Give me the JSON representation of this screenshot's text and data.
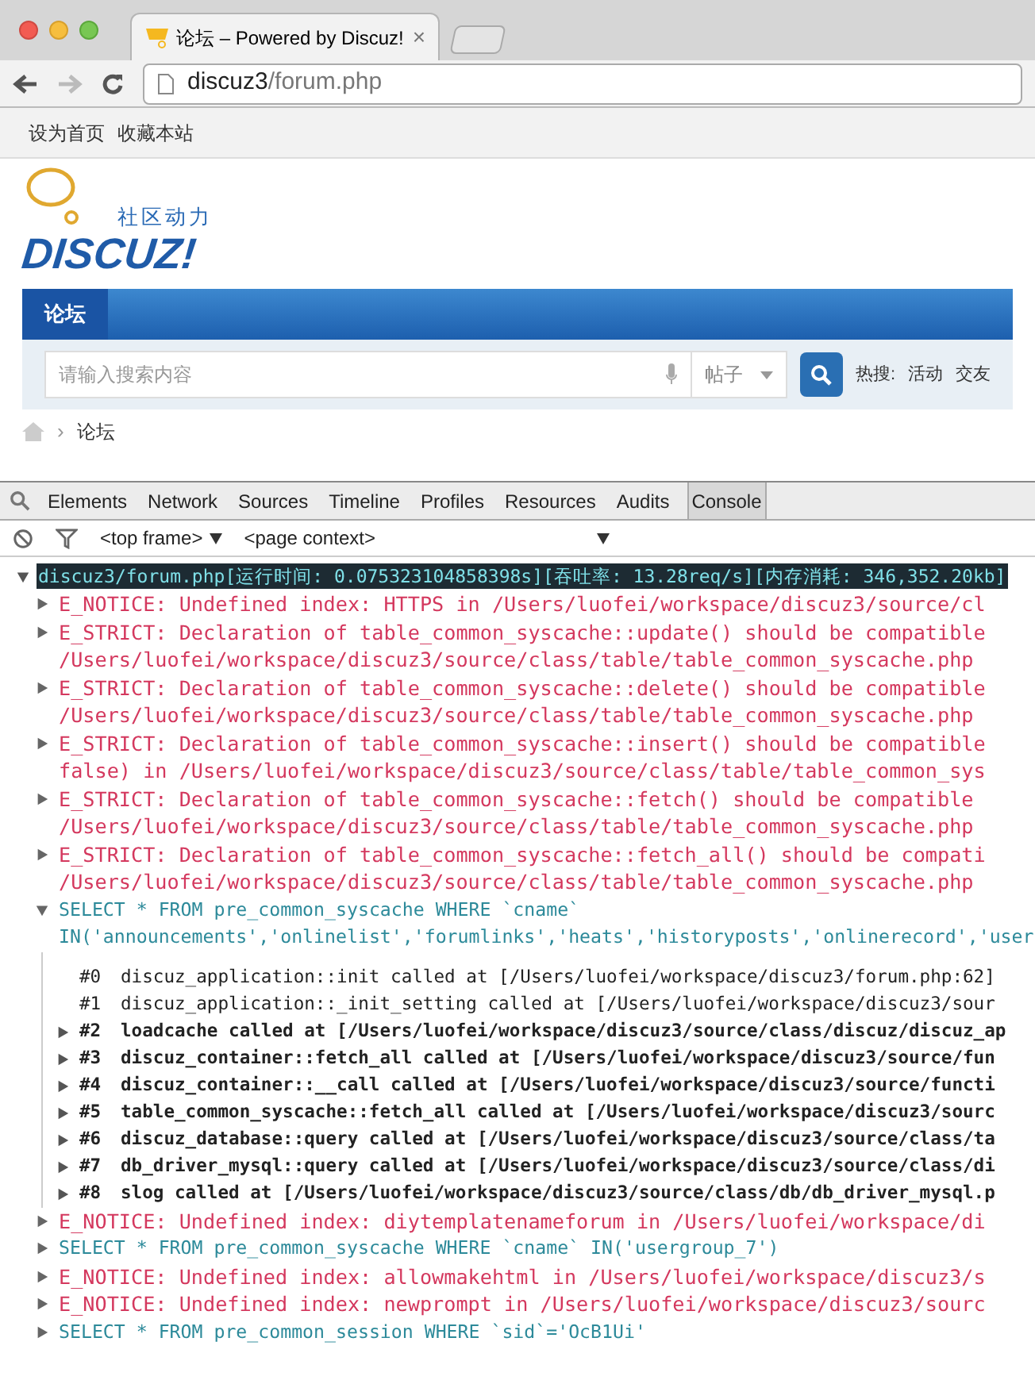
{
  "browser": {
    "tab": {
      "title": "论坛 – Powered by Discuz!",
      "close": "×"
    },
    "address": {
      "host": "discuz3",
      "path": "/forum.php"
    }
  },
  "page": {
    "top_links": [
      "设为首页",
      "收藏本站"
    ],
    "logo": {
      "slogan": "社区动力",
      "name": "DISCUZ!"
    },
    "nav": [
      {
        "label": "论坛",
        "selected": true
      }
    ],
    "search": {
      "placeholder": "请输入搜索内容",
      "type": "帖子",
      "hot_label": "热搜:",
      "hot": [
        "活动",
        "交友"
      ]
    },
    "breadcrumb": [
      {
        "separator": "›",
        "label": "论坛"
      }
    ]
  },
  "devtools": {
    "tabs": [
      {
        "label": "Elements",
        "selected": false
      },
      {
        "label": "Network",
        "selected": false
      },
      {
        "label": "Sources",
        "selected": false
      },
      {
        "label": "Timeline",
        "selected": false
      },
      {
        "label": "Profiles",
        "selected": false
      },
      {
        "label": "Resources",
        "selected": false
      },
      {
        "label": "Audits",
        "selected": false
      },
      {
        "label": "Console",
        "selected": true
      }
    ],
    "frame": "<top frame>",
    "context": "<page context>",
    "group": {
      "title": "discuz3/forum.php[运行时间: 0.075323104858398s][吞吐率: 13.28req/s][内存消耗: 346,352.20kb]",
      "expanded": true,
      "entries": [
        {
          "kind": "error",
          "expanded": false,
          "lines": [
            "E_NOTICE: Undefined index: HTTPS in /Users/luofei/workspace/discuz3/source/cl"
          ]
        },
        {
          "kind": "error",
          "expanded": false,
          "lines": [
            "E_STRICT: Declaration of table_common_syscache::update() should be compatible",
            "/Users/luofei/workspace/discuz3/source/class/table/table_common_syscache.php"
          ]
        },
        {
          "kind": "error",
          "expanded": false,
          "lines": [
            "E_STRICT: Declaration of table_common_syscache::delete() should be compatible",
            "/Users/luofei/workspace/discuz3/source/class/table/table_common_syscache.php"
          ]
        },
        {
          "kind": "error",
          "expanded": false,
          "lines": [
            "E_STRICT: Declaration of table_common_syscache::insert() should be compatible",
            "false) in /Users/luofei/workspace/discuz3/source/class/table/table_common_sys"
          ]
        },
        {
          "kind": "error",
          "expanded": false,
          "lines": [
            "E_STRICT: Declaration of table_common_syscache::fetch() should be compatible",
            "/Users/luofei/workspace/discuz3/source/class/table/table_common_syscache.php"
          ]
        },
        {
          "kind": "error",
          "expanded": false,
          "lines": [
            "E_STRICT: Declaration of table_common_syscache::fetch_all() should be compati",
            "/Users/luofei/workspace/discuz3/source/class/table/table_common_syscache.php"
          ]
        },
        {
          "kind": "sql",
          "expanded": true,
          "lines": [
            "SELECT * FROM pre_common_syscache WHERE `cname`",
            "IN('announcements','onlinelist','forumlinks','heats','historyposts','onlinerecord','user"
          ],
          "trace": [
            {
              "frame": "#0",
              "text": "discuz_application::init called at [/Users/luofei/workspace/discuz3/forum.php:62]",
              "expandable": false
            },
            {
              "frame": "#1",
              "text": "discuz_application::_init_setting called at [/Users/luofei/workspace/discuz3/sour",
              "expandable": false
            },
            {
              "frame": "#2",
              "text": "loadcache called at [/Users/luofei/workspace/discuz3/source/class/discuz/discuz_ap",
              "expandable": true
            },
            {
              "frame": "#3",
              "text": "discuz_container::fetch_all called at [/Users/luofei/workspace/discuz3/source/fun",
              "expandable": true
            },
            {
              "frame": "#4",
              "text": "discuz_container::__call called at [/Users/luofei/workspace/discuz3/source/functi",
              "expandable": true
            },
            {
              "frame": "#5",
              "text": "table_common_syscache::fetch_all called at [/Users/luofei/workspace/discuz3/sourc",
              "expandable": true
            },
            {
              "frame": "#6",
              "text": "discuz_database::query called at [/Users/luofei/workspace/discuz3/source/class/ta",
              "expandable": true
            },
            {
              "frame": "#7",
              "text": "db_driver_mysql::query called at [/Users/luofei/workspace/discuz3/source/class/di",
              "expandable": true
            },
            {
              "frame": "#8",
              "text": "slog called at [/Users/luofei/workspace/discuz3/source/class/db/db_driver_mysql.p",
              "expandable": true
            }
          ]
        },
        {
          "kind": "error",
          "expanded": false,
          "lines": [
            "E_NOTICE: Undefined index: diytemplatenameforum in /Users/luofei/workspace/di"
          ]
        },
        {
          "kind": "sql",
          "expanded": false,
          "lines": [
            "SELECT * FROM pre_common_syscache WHERE `cname` IN('usergroup_7')"
          ]
        },
        {
          "kind": "error",
          "expanded": false,
          "lines": [
            "E_NOTICE: Undefined index: allowmakehtml in /Users/luofei/workspace/discuz3/s"
          ]
        },
        {
          "kind": "error",
          "expanded": false,
          "lines": [
            "E_NOTICE: Undefined index: newprompt in /Users/luofei/workspace/discuz3/sourc"
          ]
        },
        {
          "kind": "sql",
          "expanded": false,
          "lines": [
            "SELECT * FROM pre_common_session WHERE `sid`='OcB1Ui'"
          ]
        }
      ]
    }
  }
}
